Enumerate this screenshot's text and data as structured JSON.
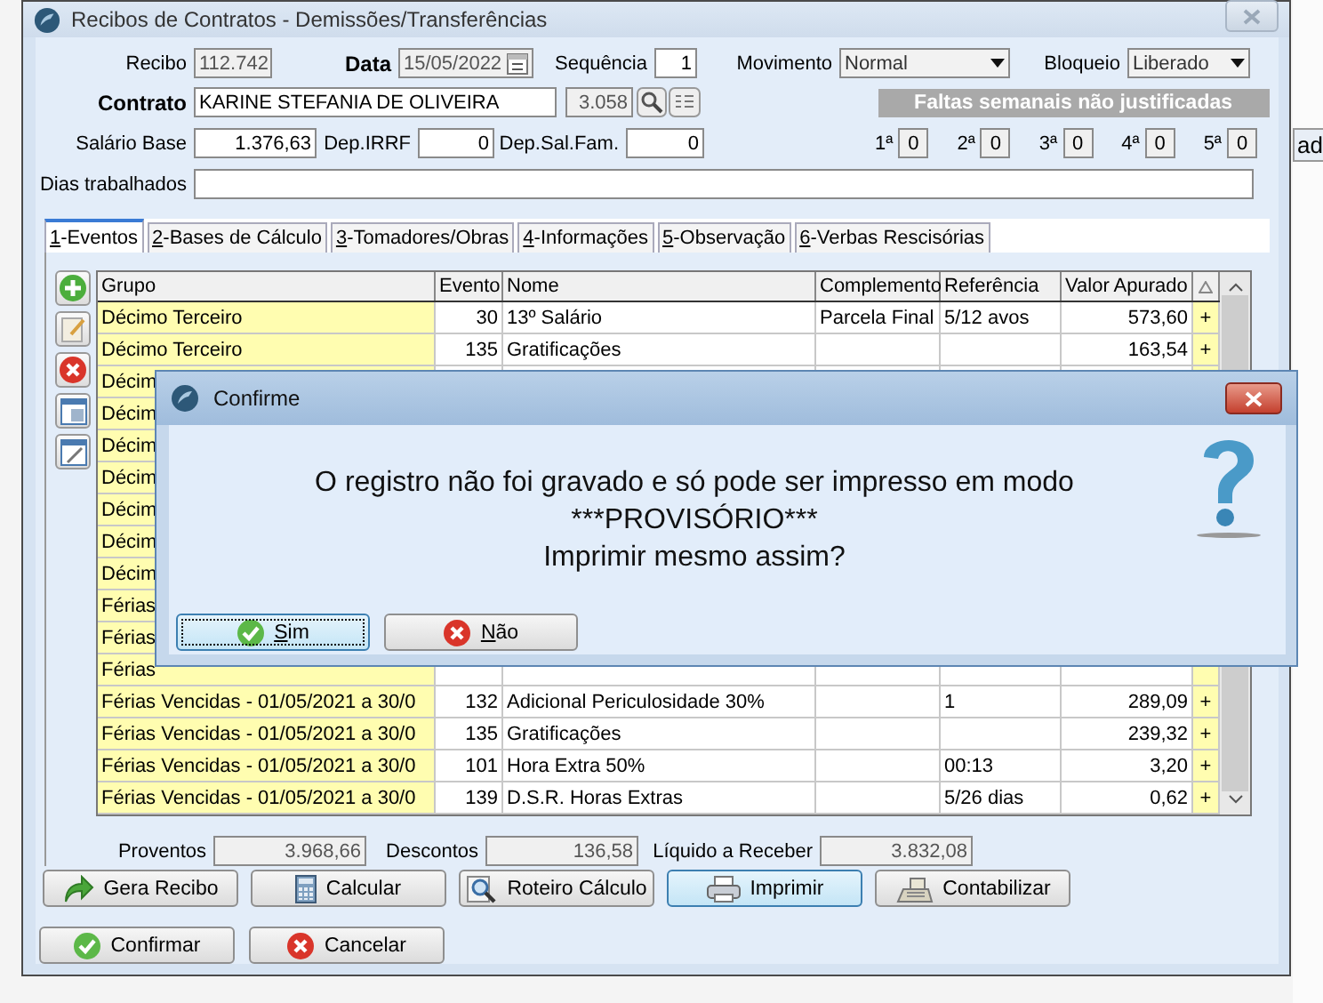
{
  "window": {
    "title": "Recibos de Contratos - Demissões/Transferências"
  },
  "form": {
    "recibo": {
      "label": "Recibo",
      "value": "112.742"
    },
    "data": {
      "label": "Data",
      "value": "15/05/2022"
    },
    "sequencia": {
      "label": "Sequência",
      "value": "1"
    },
    "movimento": {
      "label": "Movimento",
      "value": "Normal"
    },
    "bloqueio": {
      "label": "Bloqueio",
      "value": "Liberado"
    },
    "contrato": {
      "label": "Contrato",
      "value": "KARINE STEFANIA DE OLIVEIRA",
      "code": "3.058"
    },
    "salario_base": {
      "label": "Salário Base",
      "value": "1.376,63"
    },
    "dep_irrf": {
      "label": "Dep.IRRF",
      "value": "0"
    },
    "dep_sal_fam": {
      "label": "Dep.Sal.Fam.",
      "value": "0"
    },
    "dias_trabalhados": {
      "label": "Dias trabalhados"
    }
  },
  "faltas": {
    "title": "Faltas semanais não justificadas",
    "weeks": [
      {
        "label": "1ª",
        "value": "0"
      },
      {
        "label": "2ª",
        "value": "0"
      },
      {
        "label": "3ª",
        "value": "0"
      },
      {
        "label": "4ª",
        "value": "0"
      },
      {
        "label": "5ª",
        "value": "0"
      }
    ]
  },
  "tabs": [
    {
      "label": "1-Eventos",
      "selected": true
    },
    {
      "label": "2-Bases de Cálculo",
      "selected": false
    },
    {
      "label": "3-Tomadores/Obras",
      "selected": false
    },
    {
      "label": "4-Informações",
      "selected": false
    },
    {
      "label": "5-Observação",
      "selected": false
    },
    {
      "label": "6-Verbas Rescisórias",
      "selected": false
    }
  ],
  "table": {
    "columns": [
      "Grupo",
      "Evento",
      "Nome",
      "Complemento",
      "Referência",
      "Valor Apurado"
    ],
    "rows": [
      {
        "grupo": "Décimo Terceiro",
        "evento": "30",
        "nome": "13º Salário",
        "complemento": "Parcela Final",
        "referencia": "5/12 avos",
        "valor": "573,60",
        "flag": "+"
      },
      {
        "grupo": "Décimo Terceiro",
        "evento": "135",
        "nome": "Gratificações",
        "valor": "163,54",
        "flag": "+"
      },
      {
        "grupo": "Décim"
      },
      {
        "grupo": "Décim"
      },
      {
        "grupo": "Décim"
      },
      {
        "grupo": "Décim"
      },
      {
        "grupo": "Décim"
      },
      {
        "grupo": "Décim"
      },
      {
        "grupo": "Décim"
      },
      {
        "grupo": "Férias"
      },
      {
        "grupo": "Férias"
      },
      {
        "grupo": "Férias"
      },
      {
        "grupo": "Férias Vencidas - 01/05/2021 a 30/0",
        "evento": "132",
        "nome": "Adicional Periculosidade 30%",
        "referencia": "1",
        "valor": "289,09",
        "flag": "+"
      },
      {
        "grupo": "Férias Vencidas - 01/05/2021 a 30/0",
        "evento": "135",
        "nome": "Gratificações",
        "valor": "239,32",
        "flag": "+"
      },
      {
        "grupo": "Férias Vencidas - 01/05/2021 a 30/0",
        "evento": "101",
        "nome": "Hora Extra 50%",
        "referencia": "00:13",
        "valor": "3,20",
        "flag": "+"
      },
      {
        "grupo": "Férias Vencidas - 01/05/2021 a 30/0",
        "evento": "139",
        "nome": "D.S.R. Horas Extras",
        "referencia": "5/26 dias",
        "valor": "0,62",
        "flag": "+"
      }
    ]
  },
  "totals": [
    {
      "label": "Proventos",
      "value": "3.968,66"
    },
    {
      "label": "Descontos",
      "value": "136,58"
    },
    {
      "label": "Líquido a Receber",
      "value": "3.832,08"
    }
  ],
  "actions": [
    {
      "label": "Gera Recibo",
      "kind": "arrow",
      "focused": false
    },
    {
      "label": "Calcular",
      "kind": "calculator",
      "focused": false
    },
    {
      "label": "Roteiro Cálculo",
      "kind": "search",
      "focused": false
    },
    {
      "label": "Imprimir",
      "kind": "printer",
      "focused": true
    },
    {
      "label": "Contabilizar",
      "kind": "register",
      "focused": false
    }
  ],
  "footer_buttons": [
    {
      "label": "Confirmar",
      "kind": "check"
    },
    {
      "label": "Cancelar",
      "kind": "cross"
    }
  ],
  "dialog": {
    "title": "Confirme",
    "message": [
      "O registro não foi gravado e só pode ser impresso em modo",
      "***PROVISÓRIO***",
      "Imprimir mesmo assim?"
    ],
    "buttons": [
      {
        "label": "Sim",
        "kind": "check",
        "focused": true
      },
      {
        "label": "Não",
        "kind": "cross",
        "focused": false
      }
    ]
  },
  "background_fragment": "ad"
}
